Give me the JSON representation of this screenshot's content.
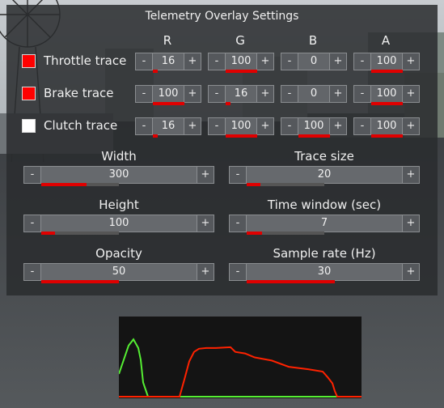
{
  "panel": {
    "title": "Telemetry Overlay Settings"
  },
  "columns": [
    "R",
    "G",
    "B",
    "A"
  ],
  "traces": [
    {
      "label": "Throttle trace",
      "swatch": "#ff0000",
      "channels": [
        {
          "value": "16",
          "level": 0.063
        },
        {
          "value": "100",
          "level": 0.39
        },
        {
          "value": "0",
          "level": 0
        },
        {
          "value": "100",
          "level": 0.39
        }
      ]
    },
    {
      "label": "Brake trace",
      "swatch": "#ff0000",
      "channels": [
        {
          "value": "100",
          "level": 0.39
        },
        {
          "value": "16",
          "level": 0.063
        },
        {
          "value": "0",
          "level": 0
        },
        {
          "value": "100",
          "level": 0.39
        }
      ]
    },
    {
      "label": "Clutch trace",
      "swatch": "#ffffff",
      "channels": [
        {
          "value": "16",
          "level": 0.063
        },
        {
          "value": "100",
          "level": 0.39
        },
        {
          "value": "100",
          "level": 0.39
        },
        {
          "value": "100",
          "level": 0.39
        }
      ]
    }
  ],
  "sliders": [
    {
      "label": "Width",
      "value": "300",
      "level": 0.29
    },
    {
      "label": "Trace size",
      "value": "20",
      "level": 0.09
    },
    {
      "label": "Height",
      "value": "100",
      "level": 0.09
    },
    {
      "label": "Time window (sec)",
      "value": "7",
      "level": 0.1
    },
    {
      "label": "Opacity",
      "value": "50",
      "level": 0.5
    },
    {
      "label": "Sample rate (Hz)",
      "value": "30",
      "level": 0.57
    }
  ],
  "controls": {
    "minus": "-",
    "plus": "+"
  },
  "colors": {
    "accent": "#e00000",
    "throttle_line": "#55ee33",
    "brake_line": "#ff2200"
  },
  "graph": {
    "throttle": [
      [
        0,
        0.71
      ],
      [
        0.02,
        0.53
      ],
      [
        0.04,
        0.35
      ],
      [
        0.06,
        0.27
      ],
      [
        0.08,
        0.38
      ],
      [
        0.09,
        0.53
      ],
      [
        0.1,
        0.82
      ],
      [
        0.12,
        1.0
      ],
      [
        0.25,
        1.0
      ],
      [
        0.45,
        1.0
      ],
      [
        0.55,
        1.0
      ],
      [
        0.6,
        1.0
      ],
      [
        0.88,
        1.0
      ],
      [
        0.92,
        1.0
      ],
      [
        1.0,
        1.0
      ]
    ],
    "brake": [
      [
        0,
        1.0
      ],
      [
        0.25,
        1.0
      ],
      [
        0.27,
        0.78
      ],
      [
        0.29,
        0.55
      ],
      [
        0.31,
        0.43
      ],
      [
        0.33,
        0.39
      ],
      [
        0.36,
        0.38
      ],
      [
        0.4,
        0.38
      ],
      [
        0.46,
        0.37
      ],
      [
        0.48,
        0.43
      ],
      [
        0.52,
        0.45
      ],
      [
        0.56,
        0.5
      ],
      [
        0.63,
        0.54
      ],
      [
        0.7,
        0.62
      ],
      [
        0.78,
        0.65
      ],
      [
        0.84,
        0.68
      ],
      [
        0.86,
        0.75
      ],
      [
        0.88,
        0.83
      ],
      [
        0.89,
        0.93
      ],
      [
        0.9,
        1.0
      ],
      [
        1.0,
        1.0
      ]
    ]
  }
}
